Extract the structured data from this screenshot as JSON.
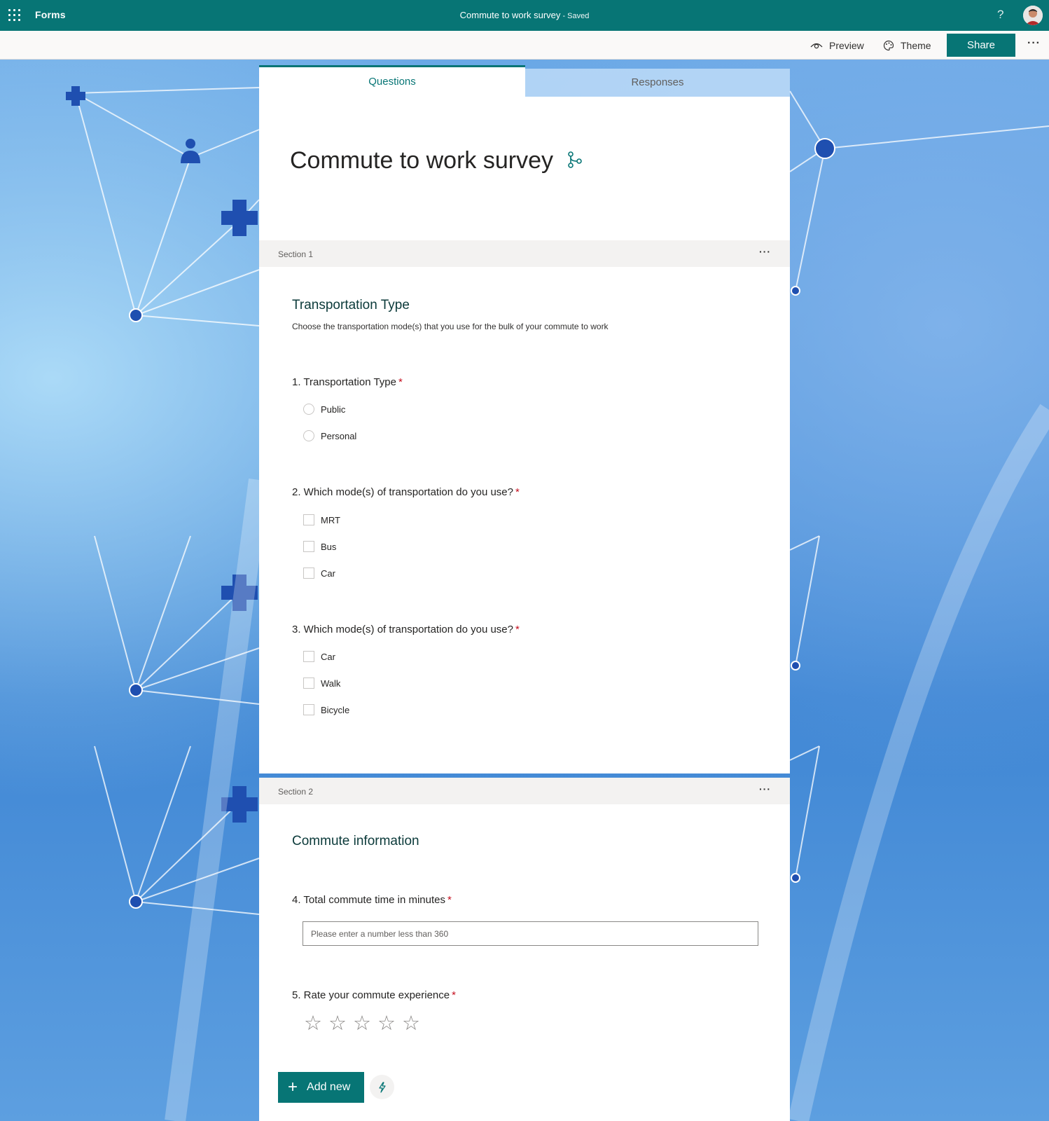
{
  "app": {
    "name": "Forms",
    "doc_title": "Commute to work survey",
    "separator": " - ",
    "save_status": "Saved",
    "help_icon": "?"
  },
  "commands": {
    "preview": "Preview",
    "theme": "Theme",
    "share": "Share",
    "more": "···"
  },
  "tabs": {
    "questions": "Questions",
    "responses": "Responses"
  },
  "form": {
    "title": "Commute to work survey"
  },
  "sections": [
    {
      "label": "Section 1",
      "more": "···",
      "title": "Transportation Type",
      "description": "Choose the transportation mode(s) that you use for the bulk of your commute to work",
      "questions": [
        {
          "text": "1. Transportation Type",
          "required_mark": "*",
          "type": "radio",
          "options": [
            "Public",
            "Personal"
          ]
        },
        {
          "text": "2. Which mode(s) of transportation do you use?",
          "required_mark": "*",
          "type": "checkbox",
          "options": [
            "MRT",
            "Bus",
            "Car"
          ]
        },
        {
          "text": "3. Which mode(s) of transportation do you use?",
          "required_mark": "*",
          "type": "checkbox",
          "options": [
            "Car",
            "Walk",
            "Bicycle"
          ]
        }
      ]
    },
    {
      "label": "Section 2",
      "more": "···",
      "title": "Commute information",
      "questions": [
        {
          "text": "4. Total commute time in minutes",
          "required_mark": "*",
          "type": "text",
          "placeholder": "Please enter a number less than 360"
        },
        {
          "text": "5. Rate your commute experience",
          "required_mark": "*",
          "type": "rating",
          "max_stars": 5,
          "star_glyph": "☆"
        }
      ]
    }
  ],
  "actions": {
    "add_new": "Add new",
    "add_icon": "+"
  },
  "colors": {
    "brand": "#077575",
    "required": "#c50f1f"
  }
}
